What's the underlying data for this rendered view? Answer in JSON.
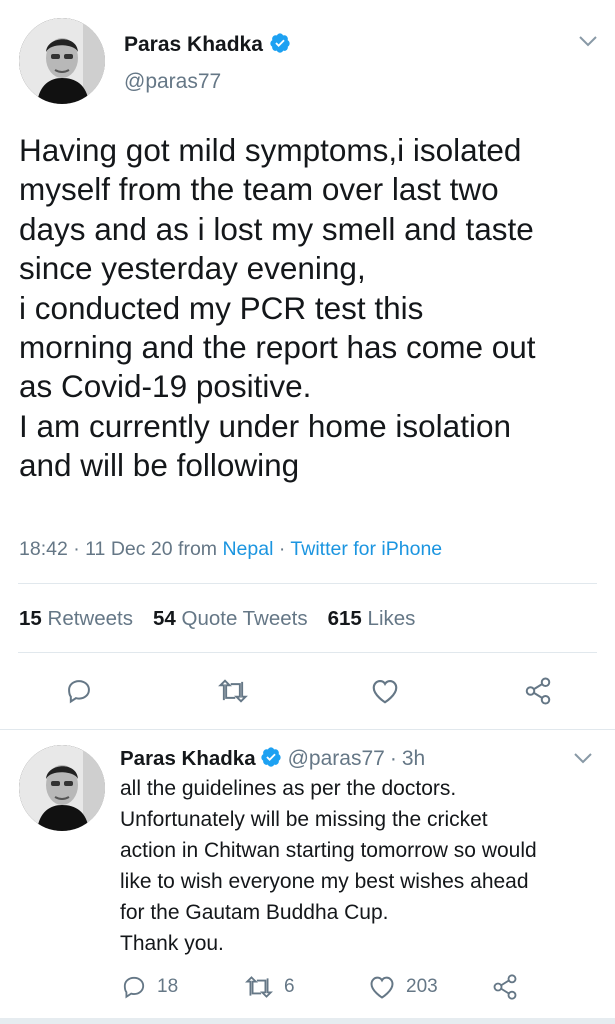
{
  "tweet": {
    "author_name": "Paras Khadka",
    "author_handle": "@paras77",
    "text": "Having got mild symptoms,i isolated\nmyself from the team over last two\ndays and as i lost my smell and taste\nsince yesterday evening,\ni conducted my PCR test this\nmorning and the report has come out\nas Covid-19 positive.\nI am currently under home isolation\nand will be following",
    "time": "18:42",
    "date": "11 Dec 20",
    "from_label": "from",
    "location": "Nepal",
    "source": "Twitter for iPhone",
    "stats": {
      "retweets_count": "15",
      "retweets_label": "Retweets",
      "quote_count": "54",
      "quote_label": "Quote Tweets",
      "likes_count": "615",
      "likes_label": "Likes"
    }
  },
  "reply": {
    "author_name": "Paras Khadka",
    "author_handle": "@paras77",
    "time_ago": "3h",
    "text": "all the guidelines as per the doctors.\nUnfortunately will be missing the cricket\naction in Chitwan starting tomorrow so would\nlike to wish everyone my best wishes ahead\nfor the Gautam Buddha Cup.\nThank you.",
    "reply_count": "18",
    "retweet_count": "6",
    "like_count": "203"
  },
  "icons": {
    "verified": "verified-badge-icon",
    "menu": "chevron-down-icon",
    "reply": "reply-icon",
    "retweet": "retweet-icon",
    "like": "heart-icon",
    "share": "share-icon"
  },
  "colors": {
    "accent": "#1da1f2",
    "link": "#1b95e0",
    "muted": "#657786",
    "text": "#14171a",
    "divider": "#e1e8ed"
  }
}
